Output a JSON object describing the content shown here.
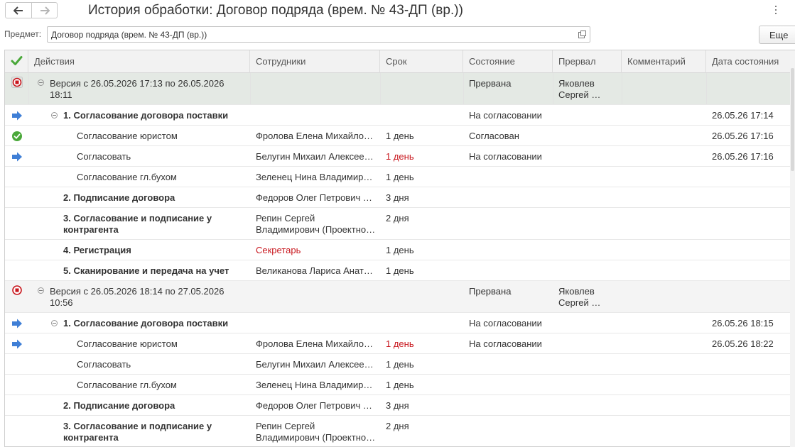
{
  "header": {
    "title": "История обработки: Договор подряда (врем. № 43-ДП (вр.))"
  },
  "subject": {
    "label": "Предмет:",
    "value": "Договор подряда (врем. № 43-ДП (вр.))"
  },
  "more_label": "Еще",
  "columns": {
    "actions": "Действия",
    "employees": "Сотрудники",
    "term": "Срок",
    "state": "Состояние",
    "interrupted": "Прервал",
    "comment": "Комментарий",
    "state_date": "Дата состояния"
  },
  "rows": [
    {
      "action": "Версия с 26.05.2026 17:13 по 26.05.2026 18:11",
      "state": "Прервана",
      "interrupted": "Яковлев Сергей …"
    },
    {
      "action": "1. Согласование договора поставки",
      "state": "На согласовании",
      "state_date": "26.05.26 17:14"
    },
    {
      "action": "Согласование юристом",
      "employees": "Фролова Елена Михайло…",
      "term": "1 день",
      "state": "Согласован",
      "state_date": "26.05.26 17:16"
    },
    {
      "action": "Согласовать",
      "employees": "Белугин Михаил Алексее…",
      "term": "1 день",
      "state": "На согласовании",
      "state_date": "26.05.26 17:16"
    },
    {
      "action": "Согласование гл.бухом",
      "employees": "Зеленец Нина Владимир…",
      "term": "1 день"
    },
    {
      "action": "2. Подписание договора",
      "employees": "Федоров Олег Петрович …",
      "term": "3 дня"
    },
    {
      "action": "3. Согласование и подписание у контрагента",
      "employees": "Репин Сергей Владимирович (Проектно…",
      "term": "2 дня"
    },
    {
      "action": "4. Регистрация",
      "employees": "Секретарь",
      "term": "1 день"
    },
    {
      "action": "5. Сканирование и передача на учет",
      "employees": "Великанова Лариса Анат…",
      "term": "1 день"
    },
    {
      "action": "Версия с 26.05.2026 18:14 по 27.05.2026 10:56",
      "state": "Прервана",
      "interrupted": "Яковлев Сергей …"
    },
    {
      "action": "1. Согласование договора поставки",
      "state": "На согласовании",
      "state_date": "26.05.26 18:15"
    },
    {
      "action": "Согласование юристом",
      "employees": "Фролова Елена Михайло…",
      "term": "1 день",
      "state": "На согласовании",
      "state_date": "26.05.26 18:22"
    },
    {
      "action": "Согласовать",
      "employees": "Белугин Михаил Алексее…",
      "term": "1 день"
    },
    {
      "action": "Согласование гл.бухом",
      "employees": "Зеленец Нина Владимир…",
      "term": "1 день"
    },
    {
      "action": "2. Подписание договора",
      "employees": "Федоров Олег Петрович …",
      "term": "3 дня"
    },
    {
      "action": "3. Согласование и подписание у контрагента",
      "employees": "Репин Сергей Владимирович (Проектно…",
      "term": "2 дня"
    }
  ],
  "colors": {
    "accent_red": "#c8161d",
    "arrow_blue": "#3f7fd6",
    "check_green": "#4aa83a"
  }
}
